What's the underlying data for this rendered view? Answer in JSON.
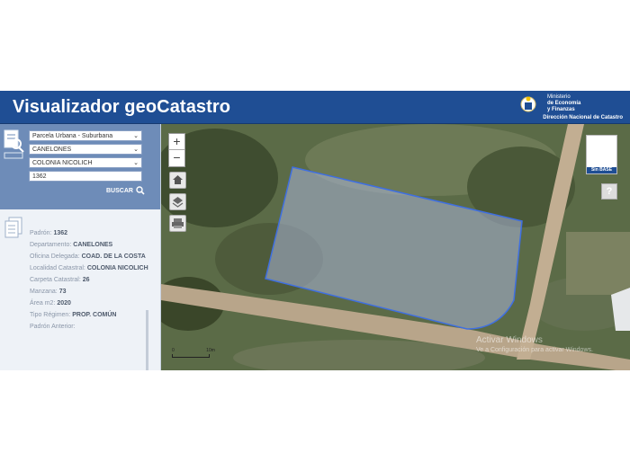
{
  "header": {
    "title": "Visualizador geoCatastro",
    "ministry": [
      "Ministerio",
      "de Economía",
      "y Finanzas"
    ],
    "department": "Dirección Nacional de Catastro"
  },
  "search": {
    "tipo": "Parcela Urbana - Suburbana",
    "departamento": "CANELONES",
    "localidad": "COLONIA NICOLICH",
    "padron": "1362",
    "buscar_label": "BUSCAR"
  },
  "info": {
    "rows": [
      {
        "label": "Padrón:",
        "value": "1362"
      },
      {
        "label": "Departamento:",
        "value": "CANELONES"
      },
      {
        "label": "Oficina Delegada:",
        "value": "COAD. DE LA COSTA"
      },
      {
        "label": "Localidad Catastral:",
        "value": "COLONIA NICOLICH"
      },
      {
        "label": "Carpeta Catastral:",
        "value": "26"
      },
      {
        "label": "Manzana:",
        "value": "73"
      },
      {
        "label": "Área m2:",
        "value": "2020"
      },
      {
        "label": "Tipo Régimen:",
        "value": "PROP. COMÚN"
      },
      {
        "label": "Padrón Anterior:",
        "value": ""
      }
    ]
  },
  "map": {
    "zoom_in": "+",
    "zoom_out": "−",
    "basemap_label": "Sin BASE",
    "help": "?",
    "scale_left": "0",
    "scale_right": "10m",
    "watermark_line1": "Activar Windows",
    "watermark_line2": "Ve a Configuración para activar Windows.",
    "parcel_outline_color": "#3f6fe0"
  },
  "colors": {
    "header_bg": "#1f4e94",
    "search_panel_bg": "#6e8cb8",
    "info_panel_bg": "#eef2f7"
  }
}
